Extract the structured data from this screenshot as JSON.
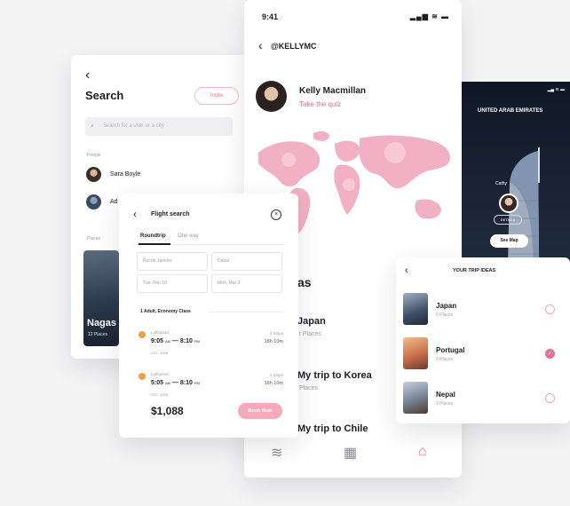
{
  "search": {
    "back_icon": "chevron-left-icon",
    "title": "Search",
    "invite_label": "Invite",
    "placeholder": "Search for a user or a city",
    "people_label": "People",
    "people": [
      {
        "name": "Sara Boyle"
      },
      {
        "name": "Ad"
      }
    ],
    "places_label": "Places",
    "place": {
      "name": "Nagas",
      "count": "12 Places"
    }
  },
  "profile": {
    "time": "9:41",
    "status_icons": "▂▄▆ ≋ ▬",
    "handle": "@KELLYMC",
    "name": "Kelly Macmillan",
    "quiz_link": "Take the quiz",
    "section_title": "as",
    "trips": [
      {
        "title": "Japan",
        "places": "t Places"
      },
      {
        "title": "My trip to Korea",
        "places": "Places"
      },
      {
        "title": "My trip to Chile",
        "places": ""
      }
    ],
    "nav": [
      "waves-icon",
      "ticket-icon",
      "backpack-icon"
    ],
    "accent": "#ee6d8a",
    "map_color": "#f3aac0"
  },
  "destination": {
    "country": "UNITED ARAB EMIRATES",
    "pin_label": "Cathy",
    "pin_button": "DETAILS",
    "see_map": "See Map"
  },
  "flight": {
    "title": "Flight search",
    "tabs": [
      "Roundtrip",
      "One way"
    ],
    "fields": {
      "from": "Rio de Janeiro",
      "to": "Dubai",
      "depart": "Tue, Feb 18",
      "return": "Mon, Mar 3"
    },
    "passengers": "1 Adult, Economy Class",
    "results": [
      {
        "airline": "Lufthansa",
        "depart": "9:05",
        "depart_suffix": "AM",
        "arrive": "8:10",
        "arrive_suffix": "PM",
        "route": "GIG - DXB",
        "stops": "2 Stops",
        "duration": "18h 10m"
      },
      {
        "airline": "Lufthansa",
        "depart": "5:05",
        "depart_suffix": "AM",
        "arrive": "8:10",
        "arrive_suffix": "PM",
        "route": "GIG - DXB",
        "stops": "2 Stops",
        "duration": "16h 10m"
      }
    ],
    "price": "$1,088",
    "book_label": "Book Now",
    "accent": "#f7a9b9"
  },
  "ideas": {
    "title": "YOUR TRIP IDEAS",
    "items": [
      {
        "name": "Japan",
        "count": "6 Places",
        "selected": false
      },
      {
        "name": "Portugal",
        "count": "9 Places",
        "selected": true
      },
      {
        "name": "Nepal",
        "count": "3 Places",
        "selected": false
      }
    ]
  }
}
